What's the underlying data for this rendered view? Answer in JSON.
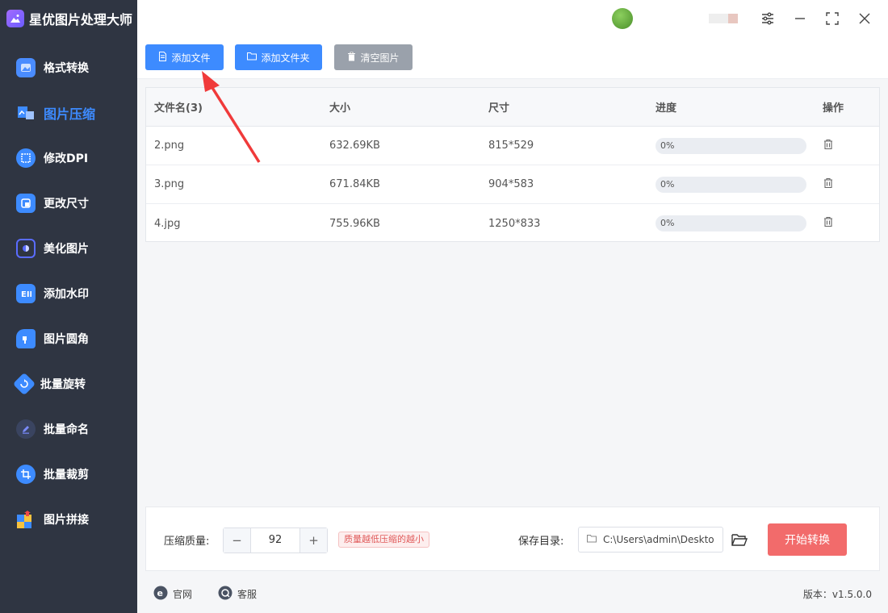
{
  "app": {
    "title": "星优图片处理大师"
  },
  "sidebar": {
    "items": [
      {
        "label": "格式转换",
        "icon": "image-convert-icon",
        "color": "#4a8cff"
      },
      {
        "label": "图片压缩",
        "icon": "image-compress-icon",
        "color": "#3d8bff",
        "active": true
      },
      {
        "label": "修改DPI",
        "icon": "dpi-icon",
        "color": "#3d8bff"
      },
      {
        "label": "更改尺寸",
        "icon": "resize-icon",
        "color": "#3d8bff"
      },
      {
        "label": "美化图片",
        "icon": "beautify-icon",
        "color": "#5a6cff"
      },
      {
        "label": "添加水印",
        "icon": "watermark-icon",
        "color": "#3d8bff"
      },
      {
        "label": "图片圆角",
        "icon": "round-corner-icon",
        "color": "#3d8bff"
      },
      {
        "label": "批量旋转",
        "icon": "rotate-icon",
        "color": "#3d8bff"
      },
      {
        "label": "批量命名",
        "icon": "rename-icon",
        "color": "#4a5cff"
      },
      {
        "label": "批量裁剪",
        "icon": "crop-icon",
        "color": "#3d8bff"
      },
      {
        "label": "图片拼接",
        "icon": "stitch-icon",
        "color": "#f04848"
      }
    ]
  },
  "toolbar": {
    "add_file": "添加文件",
    "add_folder": "添加文件夹",
    "clear_images": "清空图片"
  },
  "table": {
    "headers": [
      "文件名(3)",
      "大小",
      "尺寸",
      "进度",
      "操作"
    ],
    "rows": [
      {
        "name": "2.png",
        "size": "632.69KB",
        "dimensions": "815*529",
        "progress": "0%"
      },
      {
        "name": "3.png",
        "size": "671.84KB",
        "dimensions": "904*583",
        "progress": "0%"
      },
      {
        "name": "4.jpg",
        "size": "755.96KB",
        "dimensions": "1250*833",
        "progress": "0%"
      }
    ]
  },
  "settings": {
    "quality_label": "压缩质量:",
    "quality_value": "92",
    "decrement": "−",
    "increment": "+",
    "hint": "质量越低压缩的越小",
    "save_label": "保存目录:",
    "save_path": "C:\\Users\\admin\\Deskto",
    "start_button": "开始转换"
  },
  "footer": {
    "website": "官网",
    "support": "客服",
    "version": "版本：v1.5.0.0"
  },
  "colors": {
    "accent": "#3d8bff",
    "danger": "#f26b6b",
    "sidebar_bg": "#2f3542"
  }
}
